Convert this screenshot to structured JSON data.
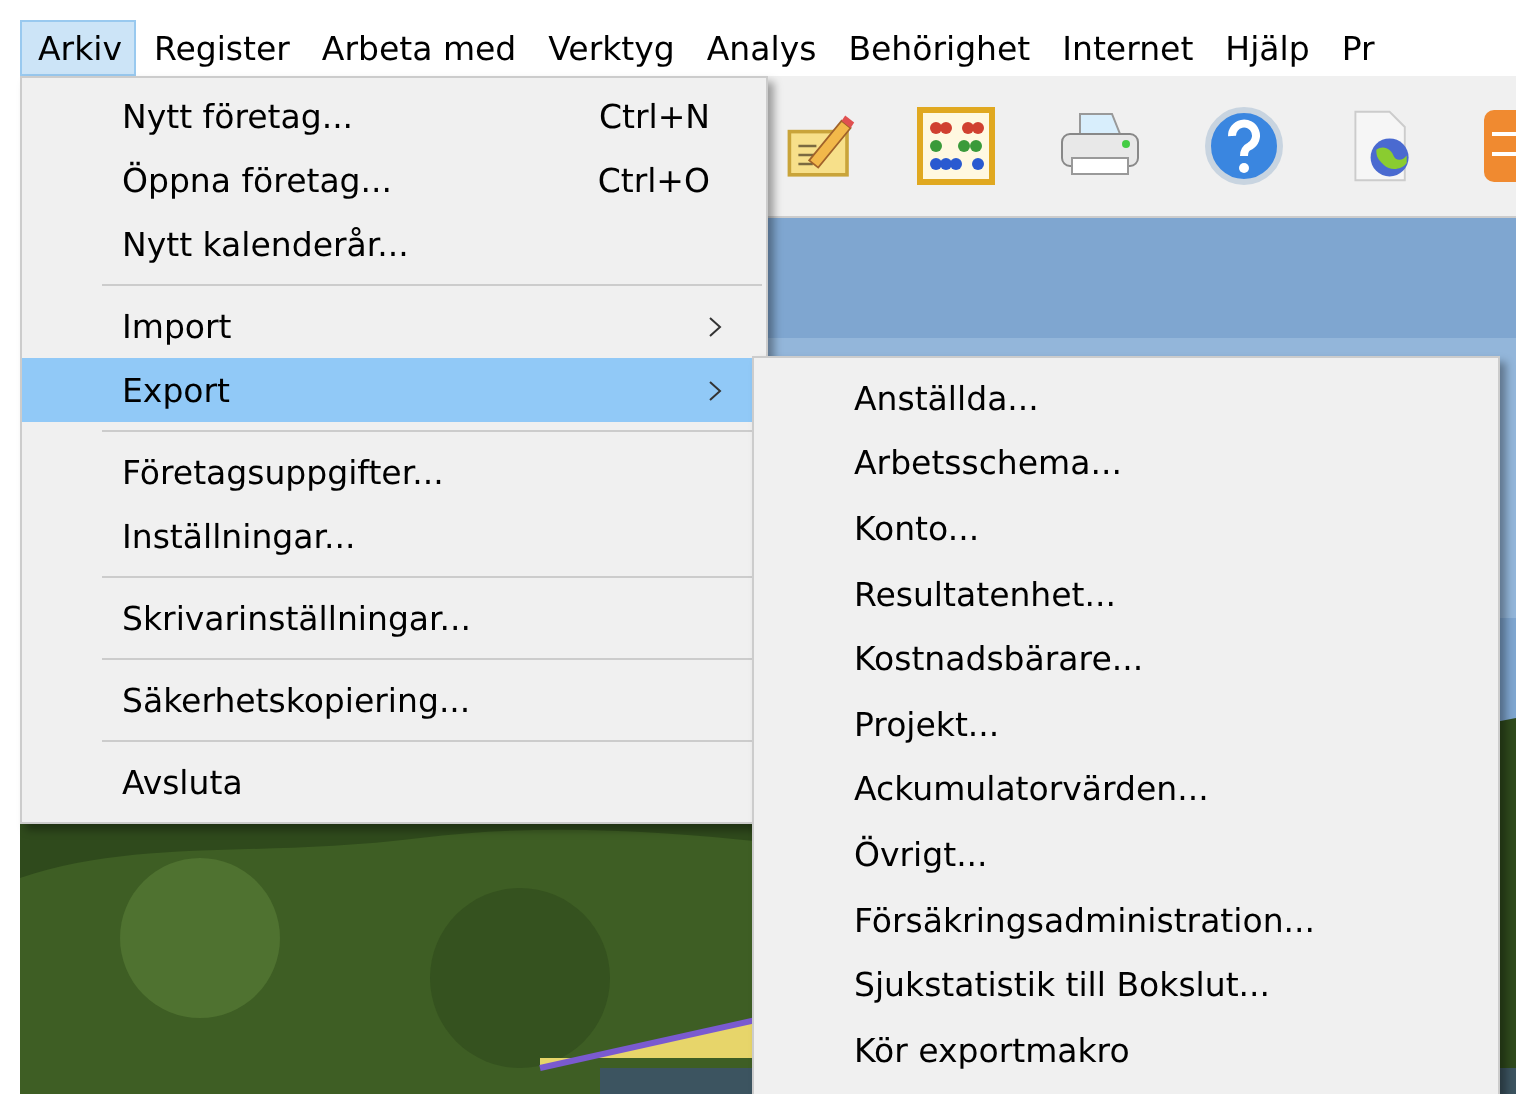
{
  "menubar": [
    {
      "label": "Arkiv",
      "selected": true
    },
    {
      "label": "Register",
      "selected": false
    },
    {
      "label": "Arbeta med",
      "selected": false
    },
    {
      "label": "Verktyg",
      "selected": false
    },
    {
      "label": "Analys",
      "selected": false
    },
    {
      "label": "Behörighet",
      "selected": false
    },
    {
      "label": "Internet",
      "selected": false
    },
    {
      "label": "Hjälp",
      "selected": false
    },
    {
      "label": "Pr",
      "selected": false
    }
  ],
  "menu": [
    {
      "kind": "item",
      "label": "Nytt företag...",
      "shortcut": "Ctrl+N",
      "submenu": false,
      "selected": false
    },
    {
      "kind": "item",
      "label": "Öppna företag...",
      "shortcut": "Ctrl+O",
      "submenu": false,
      "selected": false
    },
    {
      "kind": "item",
      "label": "Nytt kalenderår...",
      "submenu": false,
      "selected": false
    },
    {
      "kind": "separator"
    },
    {
      "kind": "item",
      "label": "Import",
      "submenu": true,
      "selected": false
    },
    {
      "kind": "item",
      "label": "Export",
      "submenu": true,
      "selected": true
    },
    {
      "kind": "separator"
    },
    {
      "kind": "item",
      "label": "Företagsuppgifter...",
      "submenu": false,
      "selected": false
    },
    {
      "kind": "item",
      "label": "Inställningar...",
      "submenu": false,
      "selected": false
    },
    {
      "kind": "separator"
    },
    {
      "kind": "item",
      "label": "Skrivarinställningar...",
      "submenu": false,
      "selected": false
    },
    {
      "kind": "separator"
    },
    {
      "kind": "item",
      "label": "Säkerhetskopiering...",
      "submenu": false,
      "selected": false
    },
    {
      "kind": "separator"
    },
    {
      "kind": "item",
      "label": "Avsluta",
      "submenu": false,
      "selected": false
    }
  ],
  "submenu": [
    {
      "label": "Anställda..."
    },
    {
      "label": "Arbetsschema..."
    },
    {
      "label": "Konto..."
    },
    {
      "label": "Resultatenhet..."
    },
    {
      "label": "Kostnadsbärare..."
    },
    {
      "label": "Projekt..."
    },
    {
      "label": "Ackumulatorvärden..."
    },
    {
      "label": "Övrigt..."
    },
    {
      "label": "Försäkringsadministration..."
    },
    {
      "label": "Sjukstatistik till Bokslut..."
    },
    {
      "label": "Kör exportmakro"
    }
  ]
}
